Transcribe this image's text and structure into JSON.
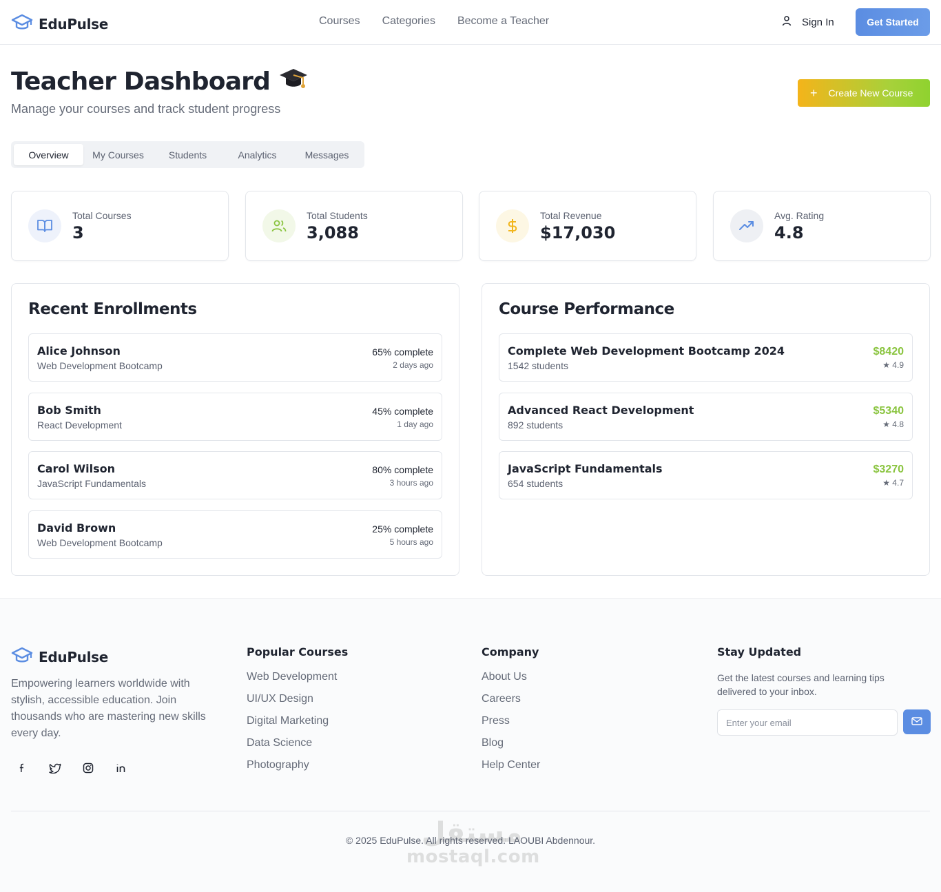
{
  "brand": {
    "name": "EduPulse"
  },
  "nav": {
    "items": [
      "Courses",
      "Categories",
      "Become a Teacher"
    ],
    "signin": "Sign In",
    "cta": "Get Started"
  },
  "page": {
    "title": "Teacher Dashboard",
    "emoji": "🎓",
    "subtitle": "Manage your courses and track student progress",
    "create_label": "Create New Course"
  },
  "tabs": [
    "Overview",
    "My Courses",
    "Students",
    "Analytics",
    "Messages"
  ],
  "active_tab": "Overview",
  "stats": [
    {
      "label": "Total Courses",
      "value": "3",
      "icon": "book-open-icon",
      "color": "#5b8de2"
    },
    {
      "label": "Total Students",
      "value": "3,088",
      "icon": "users-icon",
      "color": "#8ac43f"
    },
    {
      "label": "Total Revenue",
      "value": "$17,030",
      "icon": "dollar-icon",
      "color": "#f2b51b"
    },
    {
      "label": "Avg. Rating",
      "value": "4.8",
      "icon": "trending-up-icon",
      "color": "#5b8de2"
    }
  ],
  "enrollments": {
    "title": "Recent Enrollments",
    "items": [
      {
        "name": "Alice Johnson",
        "course": "Web Development Bootcamp",
        "progress": "65% complete",
        "time": "2 days ago"
      },
      {
        "name": "Bob Smith",
        "course": "React Development",
        "progress": "45% complete",
        "time": "1 day ago"
      },
      {
        "name": "Carol Wilson",
        "course": "JavaScript Fundamentals",
        "progress": "80% complete",
        "time": "3 hours ago"
      },
      {
        "name": "David Brown",
        "course": "Web Development Bootcamp",
        "progress": "25% complete",
        "time": "5 hours ago"
      }
    ]
  },
  "performance": {
    "title": "Course Performance",
    "items": [
      {
        "name": "Complete Web Development Bootcamp 2024",
        "students": "1542 students",
        "revenue": "$8420",
        "rating": "★ 4.9"
      },
      {
        "name": "Advanced React Development",
        "students": "892 students",
        "revenue": "$5340",
        "rating": "★ 4.8"
      },
      {
        "name": "JavaScript Fundamentals",
        "students": "654 students",
        "revenue": "$3270",
        "rating": "★ 4.7"
      }
    ]
  },
  "footer": {
    "description": "Empowering learners worldwide with stylish, accessible education. Join thousands who are mastering new skills every day.",
    "socials": [
      "facebook-icon",
      "twitter-icon",
      "instagram-icon",
      "linkedin-icon"
    ],
    "popular": {
      "title": "Popular Courses",
      "links": [
        "Web Development",
        "UI/UX Design",
        "Digital Marketing",
        "Data Science",
        "Photography"
      ]
    },
    "company": {
      "title": "Company",
      "links": [
        "About Us",
        "Careers",
        "Press",
        "Blog",
        "Help Center"
      ]
    },
    "newsletter": {
      "title": "Stay Updated",
      "description": "Get the latest courses and learning tips delivered to your inbox.",
      "placeholder": "Enter your email"
    },
    "copyright": "© 2025 EduPulse. All rights reserved. LAOUBI Abdennour."
  },
  "watermark": {
    "arabic": "مستقل",
    "latin": "mostaql.com"
  }
}
